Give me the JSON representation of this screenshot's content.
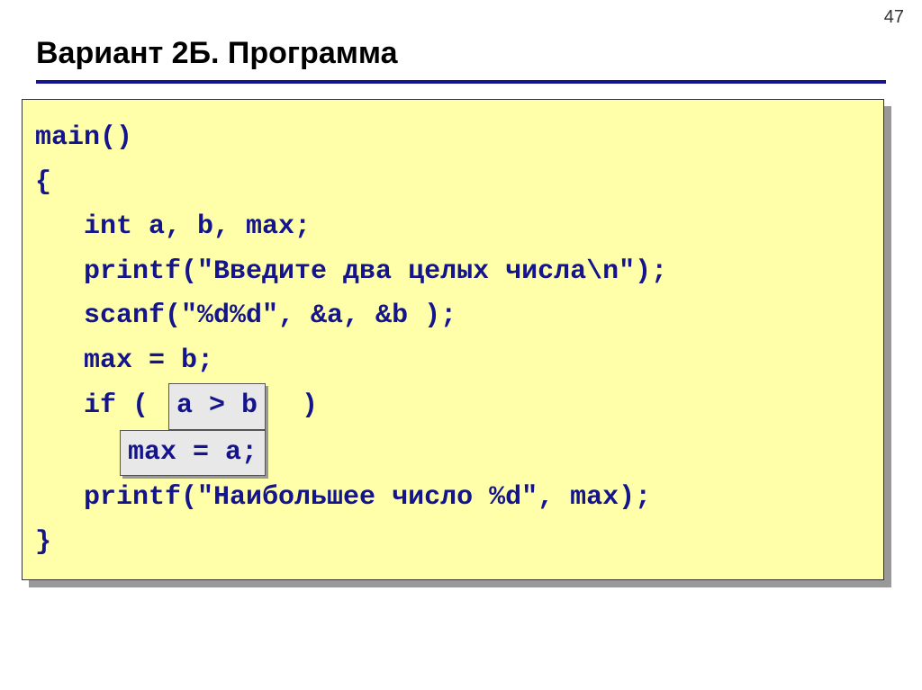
{
  "page_number": "47",
  "title": "Вариант 2Б. Программа",
  "code": {
    "l1": "main()",
    "l2": "{",
    "l3": "   int a, b, max;",
    "l4": "   printf(\"Введите два целых числа\\n\");",
    "l5": "   scanf(\"%d%d\", &a, &b );",
    "l6": "   max = b;",
    "l7_pre": "   if ( ",
    "l7_box": "a > b",
    "l7_post": "  )",
    "l8_pre": "     ",
    "l8_box": "max = a;",
    "l9": "   printf(\"Наибольшее число %d\", max);",
    "l10": "}"
  }
}
